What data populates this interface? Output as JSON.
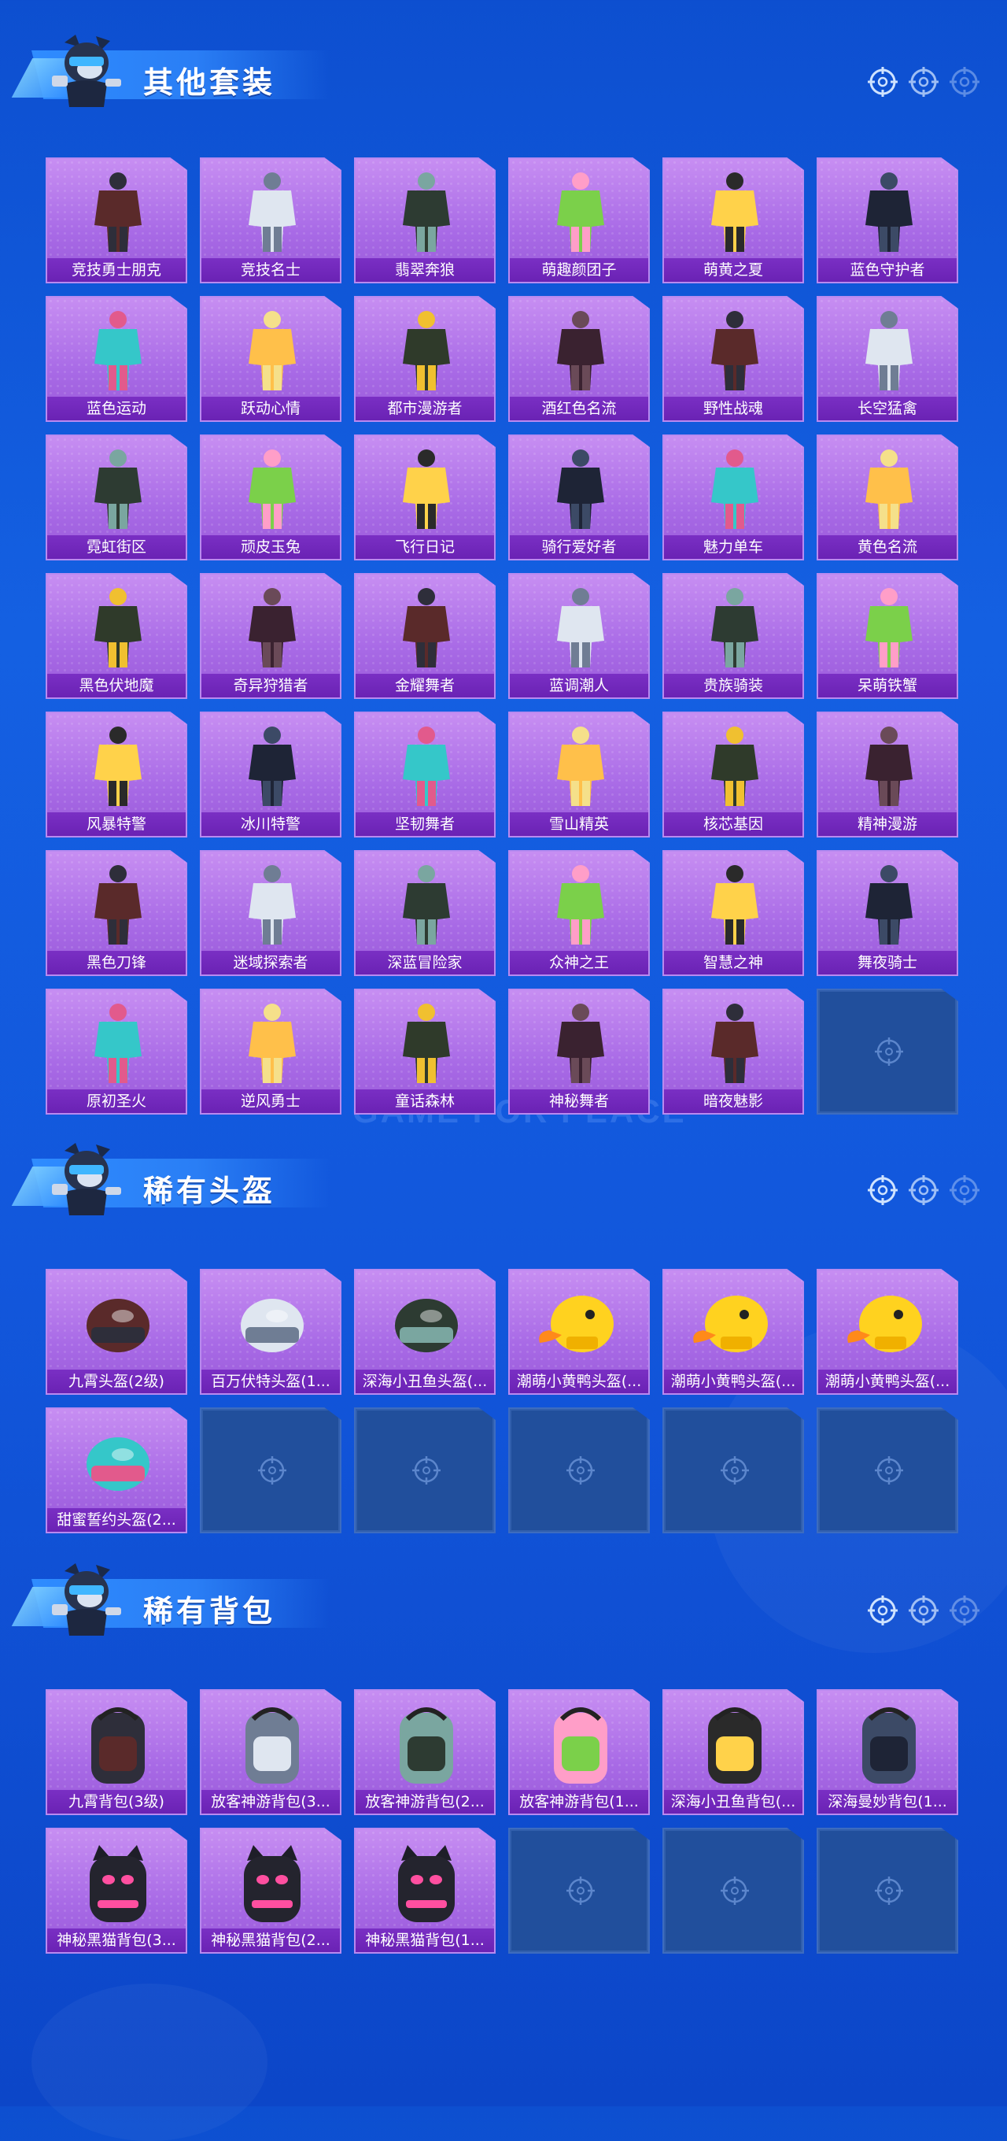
{
  "colors": {
    "background": "#1460e2",
    "card": "#a86ae6",
    "card_label": "#6a22b4",
    "empty_slot": "#214f9c",
    "banner": "#2f8cff",
    "title_text": "#ffffff"
  },
  "watermark": "GAME FOR PEACE",
  "sections": [
    {
      "title": "其他套装",
      "items": [
        {
          "label": "竞技勇士朋克",
          "icon": "outfit-icon"
        },
        {
          "label": "竞技名士",
          "icon": "outfit-icon"
        },
        {
          "label": "翡翠奔狼",
          "icon": "outfit-icon"
        },
        {
          "label": "萌趣颜团子",
          "icon": "outfit-icon"
        },
        {
          "label": "萌黄之夏",
          "icon": "outfit-icon"
        },
        {
          "label": "蓝色守护者",
          "icon": "outfit-icon"
        },
        {
          "label": "蓝色运动",
          "icon": "outfit-icon"
        },
        {
          "label": "跃动心情",
          "icon": "outfit-icon"
        },
        {
          "label": "都市漫游者",
          "icon": "outfit-icon"
        },
        {
          "label": "酒红色名流",
          "icon": "outfit-icon"
        },
        {
          "label": "野性战魂",
          "icon": "outfit-icon"
        },
        {
          "label": "长空猛禽",
          "icon": "outfit-icon"
        },
        {
          "label": "霓虹街区",
          "icon": "outfit-icon"
        },
        {
          "label": "顽皮玉兔",
          "icon": "outfit-icon"
        },
        {
          "label": "飞行日记",
          "icon": "outfit-icon"
        },
        {
          "label": "骑行爱好者",
          "icon": "outfit-icon"
        },
        {
          "label": "魅力单车",
          "icon": "outfit-icon"
        },
        {
          "label": "黄色名流",
          "icon": "outfit-icon"
        },
        {
          "label": "黑色伏地魔",
          "icon": "outfit-icon"
        },
        {
          "label": "奇异狩猎者",
          "icon": "outfit-icon"
        },
        {
          "label": "金耀舞者",
          "icon": "outfit-icon"
        },
        {
          "label": "蓝调潮人",
          "icon": "outfit-icon"
        },
        {
          "label": "贵族骑装",
          "icon": "outfit-icon"
        },
        {
          "label": "呆萌铁蟹",
          "icon": "outfit-icon"
        },
        {
          "label": "风暴特警",
          "icon": "outfit-icon"
        },
        {
          "label": "冰川特警",
          "icon": "outfit-icon"
        },
        {
          "label": "坚韧舞者",
          "icon": "outfit-icon"
        },
        {
          "label": "雪山精英",
          "icon": "outfit-icon"
        },
        {
          "label": "核芯基因",
          "icon": "outfit-icon"
        },
        {
          "label": "精神漫游",
          "icon": "outfit-icon"
        },
        {
          "label": "黑色刀锋",
          "icon": "outfit-icon"
        },
        {
          "label": "迷域探索者",
          "icon": "outfit-icon"
        },
        {
          "label": "深蓝冒险家",
          "icon": "outfit-icon"
        },
        {
          "label": "众神之王",
          "icon": "outfit-icon"
        },
        {
          "label": "智慧之神",
          "icon": "outfit-icon"
        },
        {
          "label": "舞夜骑士",
          "icon": "outfit-icon"
        },
        {
          "label": "原初圣火",
          "icon": "outfit-icon"
        },
        {
          "label": "逆风勇士",
          "icon": "outfit-icon"
        },
        {
          "label": "童话森林",
          "icon": "outfit-icon"
        },
        {
          "label": "神秘舞者",
          "icon": "outfit-icon"
        },
        {
          "label": "暗夜魅影",
          "icon": "outfit-icon"
        }
      ],
      "empty_slots": 1
    },
    {
      "title": "稀有头盔",
      "items": [
        {
          "label": "九霄头盔(2级)",
          "icon": "helmet-icon"
        },
        {
          "label": "百万伏特头盔(1...",
          "icon": "helmet-icon"
        },
        {
          "label": "深海小丑鱼头盔(...",
          "icon": "helmet-icon"
        },
        {
          "label": "潮萌小黄鸭头盔(...",
          "icon": "duck-helmet-icon"
        },
        {
          "label": "潮萌小黄鸭头盔(...",
          "icon": "duck-helmet-icon"
        },
        {
          "label": "潮萌小黄鸭头盔(...",
          "icon": "duck-helmet-icon"
        },
        {
          "label": "甜蜜誓约头盔(2...",
          "icon": "helmet-icon"
        }
      ],
      "empty_slots": 5
    },
    {
      "title": "稀有背包",
      "items": [
        {
          "label": "九霄背包(3级)",
          "icon": "backpack-icon"
        },
        {
          "label": "放客神游背包(3...",
          "icon": "backpack-icon"
        },
        {
          "label": "放客神游背包(2...",
          "icon": "backpack-icon"
        },
        {
          "label": "放客神游背包(1...",
          "icon": "backpack-icon"
        },
        {
          "label": "深海小丑鱼背包(...",
          "icon": "backpack-icon"
        },
        {
          "label": "深海曼妙背包(1...",
          "icon": "backpack-icon"
        },
        {
          "label": "神秘黑猫背包(3...",
          "icon": "cat-backpack-icon"
        },
        {
          "label": "神秘黑猫背包(2...",
          "icon": "cat-backpack-icon"
        },
        {
          "label": "神秘黑猫背包(1...",
          "icon": "cat-backpack-icon"
        }
      ],
      "empty_slots": 3
    }
  ]
}
